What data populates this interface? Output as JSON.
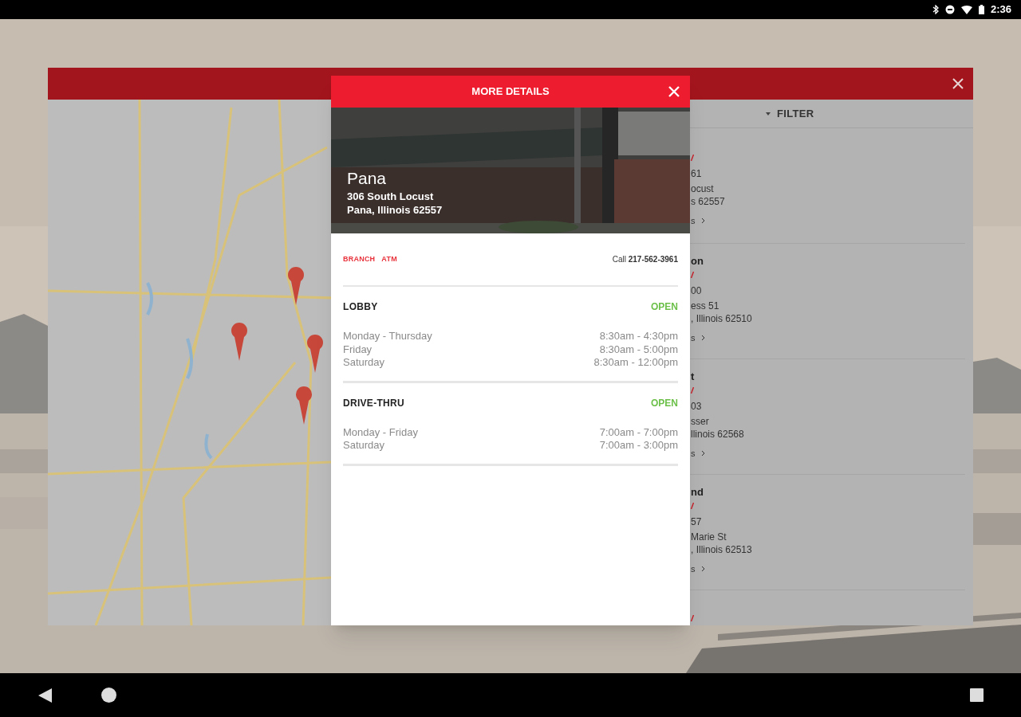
{
  "status_bar": {
    "time": "2:36"
  },
  "locator": {
    "filter_label": "FILTER",
    "list_items": [
      {
        "kind": "full",
        "phone": "61",
        "street": "ocust",
        "city": "s 62557",
        "link": "s"
      },
      {
        "kind": "full",
        "name": "on",
        "phone": "00",
        "street": "ess 51",
        "city": ", Illinois 62510",
        "link": "s"
      },
      {
        "kind": "full",
        "name": "t",
        "phone": "03",
        "street": "sser",
        "city": "llinois 62568",
        "link": "s"
      },
      {
        "kind": "full",
        "name": "nd",
        "phone": "57",
        "street": "Marie St",
        "city": ", Illinois 62513",
        "link": "s"
      },
      {
        "kind": "cut"
      }
    ]
  },
  "details": {
    "title": "MORE DETAILS",
    "name": "Pana",
    "address_lines": [
      "306 South Locust",
      "Pana, Illinois 62557"
    ],
    "tags": [
      "BRANCH",
      "ATM"
    ],
    "call_label": "Call",
    "phone": "217-562-3961",
    "sections": [
      {
        "title": "LOBBY",
        "status": "OPEN",
        "hours": [
          {
            "days": "Monday - Thursday",
            "time": "8:30am - 4:30pm"
          },
          {
            "days": "Friday",
            "time": "8:30am - 5:00pm"
          },
          {
            "days": "Saturday",
            "time": "8:30am - 12:00pm"
          }
        ]
      },
      {
        "title": "DRIVE-THRU",
        "status": "OPEN",
        "hours": [
          {
            "days": "Monday - Friday",
            "time": "7:00am - 7:00pm"
          },
          {
            "days": "Saturday",
            "time": "7:00am - 3:00pm"
          }
        ]
      }
    ]
  }
}
